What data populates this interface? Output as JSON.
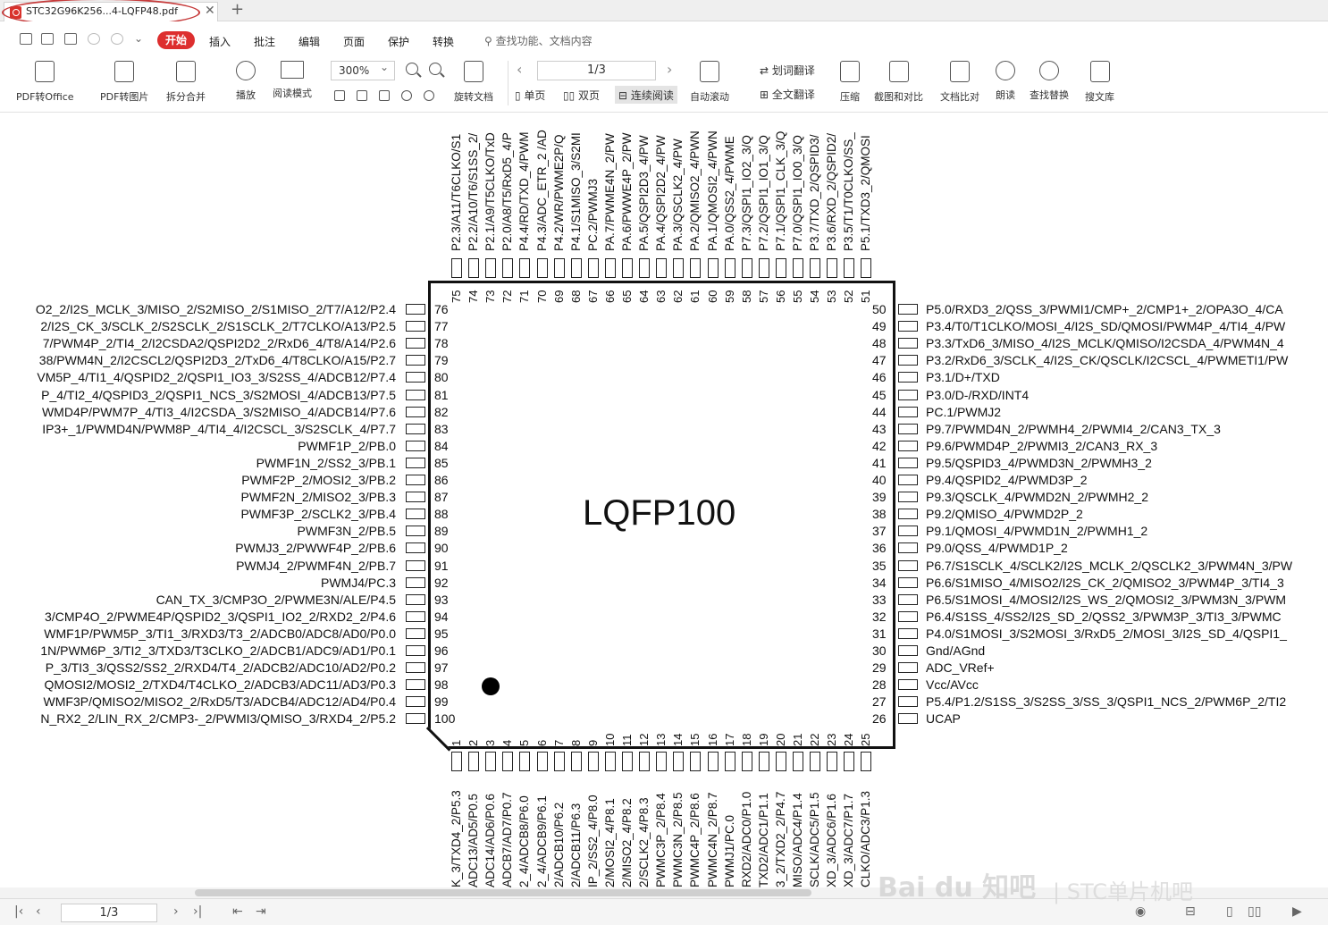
{
  "tab": {
    "title": "STC32G96K256...4-LQFP48.pdf",
    "close": "✕",
    "new_tab": "+"
  },
  "menu": {
    "items": [
      "开始",
      "插入",
      "批注",
      "编辑",
      "页面",
      "保护",
      "转换"
    ],
    "search_placeholder": "查找功能、文档内容"
  },
  "toolbar": {
    "pdf_to_office": "PDF转Office",
    "pdf_to_image": "PDF转图片",
    "split_merge": "拆分合并",
    "play": "播放",
    "read_mode": "阅读模式",
    "zoom": "300%",
    "page": "1/3",
    "rotate": "旋转文档",
    "single": "单页",
    "double": "双页",
    "continuous": "连续阅读",
    "auto_scroll": "自动滚动",
    "translate_word": "划词翻译",
    "translate_full": "全文翻译",
    "compress": "压缩",
    "screenshot_compare": "截图和对比",
    "doc_compare": "文档比对",
    "read_aloud": "朗读",
    "find_replace": "查找替换",
    "search_lib": "搜文库"
  },
  "chip": {
    "name": "LQFP100",
    "left_pins": [
      {
        "num": "76",
        "label": "O2_2/I2S_MCLK_3/MISO_2/S2MISO_2/S1MISO_2/T7/A12/P2.4"
      },
      {
        "num": "77",
        "label": "2/I2S_CK_3/SCLK_2/S2SCLK_2/S1SCLK_2/T7CLKO/A13/P2.5"
      },
      {
        "num": "78",
        "label": "7/PWM4P_2/TI4_2/I2CSDA2/QSPI2D2_2/RxD6_4/T8/A14/P2.6"
      },
      {
        "num": "79",
        "label": "38/PWM4N_2/I2CSCL2/QSPI2D3_2/TxD6_4/T8CLKO/A15/P2.7"
      },
      {
        "num": "80",
        "label": "VM5P_4/TI1_4/QSPID2_2/QSPI1_IO3_3/S2SS_4/ADCB12/P7.4"
      },
      {
        "num": "81",
        "label": "P_4/TI2_4/QSPID3_2/QSPI1_NCS_3/S2MOSI_4/ADCB13/P7.5"
      },
      {
        "num": "82",
        "label": "WMD4P/PWM7P_4/TI3_4/I2CSDA_3/S2MISO_4/ADCB14/P7.6"
      },
      {
        "num": "83",
        "label": "IP3+_1/PWMD4N/PWM8P_4/TI4_4/I2CSCL_3/S2SCLK_4/P7.7"
      },
      {
        "num": "84",
        "label": "PWMF1P_2/PB.0"
      },
      {
        "num": "85",
        "label": "PWMF1N_2/SS2_3/PB.1"
      },
      {
        "num": "86",
        "label": "PWMF2P_2/MOSI2_3/PB.2"
      },
      {
        "num": "87",
        "label": "PWMF2N_2/MISO2_3/PB.3"
      },
      {
        "num": "88",
        "label": "PWMF3P_2/SCLK2_3/PB.4"
      },
      {
        "num": "89",
        "label": "PWMF3N_2/PB.5"
      },
      {
        "num": "90",
        "label": "PWMJ3_2/PWWF4P_2/PB.6"
      },
      {
        "num": "91",
        "label": "PWMJ4_2/PWMF4N_2/PB.7"
      },
      {
        "num": "92",
        "label": "PWMJ4/PC.3"
      },
      {
        "num": "93",
        "label": "CAN_TX_3/CMP3O_2/PWME3N/ALE/P4.5"
      },
      {
        "num": "94",
        "label": "3/CMP4O_2/PWME4P/QSPID2_3/QSPI1_IO2_2/RXD2_2/P4.6"
      },
      {
        "num": "95",
        "label": "WMF1P/PWM5P_3/TI1_3/RXD3/T3_2/ADCB0/ADC8/AD0/P0.0"
      },
      {
        "num": "96",
        "label": "1N/PWM6P_3/TI2_3/TXD3/T3CLKO_2/ADCB1/ADC9/AD1/P0.1"
      },
      {
        "num": "97",
        "label": "P_3/TI3_3/QSS2/SS2_2/RXD4/T4_2/ADCB2/ADC10/AD2/P0.2"
      },
      {
        "num": "98",
        "label": "QMOSI2/MOSI2_2/TXD4/T4CLKO_2/ADCB3/ADC11/AD3/P0.3"
      },
      {
        "num": "99",
        "label": "WMF3P/QMISO2/MISO2_2/RxD5/T3/ADCB4/ADC12/AD4/P0.4"
      },
      {
        "num": "100",
        "label": "N_RX2_2/LIN_RX_2/CMP3-_2/PWMI3/QMISO_3/RXD4_2/P5.2"
      }
    ],
    "right_pins": [
      {
        "num": "50",
        "label": "P5.0/RXD3_2/QSS_3/PWMI1/CMP+_2/CMP1+_2/OPA3O_4/CA"
      },
      {
        "num": "49",
        "label": "P3.4/T0/T1CLKO/MOSI_4/I2S_SD/QMOSI/PWM4P_4/TI4_4/PW"
      },
      {
        "num": "48",
        "label": "P3.3/TxD6_3/MISO_4/I2S_MCLK/QMISO/I2CSDA_4/PWM4N_4"
      },
      {
        "num": "47",
        "label": "P3.2/RxD6_3/SCLK_4/I2S_CK/QSCLK/I2CSCL_4/PWMETI1/PW"
      },
      {
        "num": "46",
        "label": "P3.1/D+/TXD"
      },
      {
        "num": "45",
        "label": "P3.0/D-/RXD/INT4"
      },
      {
        "num": "44",
        "label": "PC.1/PWMJ2"
      },
      {
        "num": "43",
        "label": "P9.7/PWMD4N_2/PWMH4_2/PWMI4_2/CAN3_TX_3"
      },
      {
        "num": "42",
        "label": "P9.6/PWMD4P_2/PWMI3_2/CAN3_RX_3"
      },
      {
        "num": "41",
        "label": "P9.5/QSPID3_4/PWMD3N_2/PWMH3_2"
      },
      {
        "num": "40",
        "label": "P9.4/QSPID2_4/PWMD3P_2"
      },
      {
        "num": "39",
        "label": "P9.3/QSCLK_4/PWMD2N_2/PWMH2_2"
      },
      {
        "num": "38",
        "label": "P9.2/QMISO_4/PWMD2P_2"
      },
      {
        "num": "37",
        "label": "P9.1/QMOSI_4/PWMD1N_2/PWMH1_2"
      },
      {
        "num": "36",
        "label": "P9.0/QSS_4/PWMD1P_2"
      },
      {
        "num": "35",
        "label": "P6.7/S1SCLK_4/SCLK2/I2S_MCLK_2/QSCLK2_3/PWM4N_3/PW"
      },
      {
        "num": "34",
        "label": "P6.6/S1MISO_4/MISO2/I2S_CK_2/QMISO2_3/PWM4P_3/TI4_3"
      },
      {
        "num": "33",
        "label": "P6.5/S1MOSI_4/MOSI2/I2S_WS_2/QMOSI2_3/PWM3N_3/PWM"
      },
      {
        "num": "32",
        "label": "P6.4/S1SS_4/SS2/I2S_SD_2/QSS2_3/PWM3P_3/TI3_3/PWMC"
      },
      {
        "num": "31",
        "label": "P4.0/S1MOSI_3/S2MOSI_3/RxD5_2/MOSI_3/I2S_SD_4/QSPI1_"
      },
      {
        "num": "30",
        "label": "Gnd/AGnd"
      },
      {
        "num": "29",
        "label": "ADC_VRef+"
      },
      {
        "num": "28",
        "label": "Vcc/AVcc"
      },
      {
        "num": "27",
        "label": "P5.4/P1.2/S1SS_3/S2SS_3/SS_3/QSPI1_NCS_2/PWM6P_2/TI2"
      },
      {
        "num": "26",
        "label": "UCAP"
      }
    ],
    "top_pins": [
      {
        "num": "75",
        "label": "P2.3/A11/T6CLKO/S1"
      },
      {
        "num": "74",
        "label": "P2.2/A10/T6/S1SS_2/"
      },
      {
        "num": "73",
        "label": "P2.1/A9/T5CLKO/TxD"
      },
      {
        "num": "72",
        "label": "P2.0/A8/T5/RxD5_4/P"
      },
      {
        "num": "71",
        "label": "P4.4/RD/TXD_4/PWM"
      },
      {
        "num": "70",
        "label": "P4.3/ADC_ETR_2 /AD"
      },
      {
        "num": "69",
        "label": "P4.2/WR/PWME2P/Q"
      },
      {
        "num": "68",
        "label": "P4.1/S1MISO_3/S2MI"
      },
      {
        "num": "67",
        "label": "PC.2/PWMJ3"
      },
      {
        "num": "66",
        "label": "PA.7/PWME4N_2/PW"
      },
      {
        "num": "65",
        "label": "PA.6/PWWE4P_2/PW"
      },
      {
        "num": "64",
        "label": "PA.5/QSPI2D3_4/PW"
      },
      {
        "num": "63",
        "label": "PA.4/QSPI2D2_4/PW"
      },
      {
        "num": "62",
        "label": "PA.3/QSCLK2_4/PW"
      },
      {
        "num": "61",
        "label": "PA.2/QMISO2_4/PWN"
      },
      {
        "num": "60",
        "label": "PA.1/QMOSI2_4/PWN"
      },
      {
        "num": "59",
        "label": "PA.0/QSS2_4/PWME"
      },
      {
        "num": "58",
        "label": "P7.3/QSPI1_IO2_3/Q"
      },
      {
        "num": "57",
        "label": "P7.2/QSPI1_IO1_3/Q"
      },
      {
        "num": "56",
        "label": "P7.1/QSPI1_CLK_3/Q"
      },
      {
        "num": "55",
        "label": "P7.0/QSPI1_IO0_3/Q"
      },
      {
        "num": "54",
        "label": "P3.7/TXD_2/QSPID3/"
      },
      {
        "num": "53",
        "label": "P3.6/RXD_2/QSPID2/"
      },
      {
        "num": "52",
        "label": "P3.5/T1/T0CLKO/SS_"
      },
      {
        "num": "51",
        "label": "P5.1/TXD3_2/QMOSI"
      }
    ],
    "bottom_pins": [
      {
        "num": "1",
        "label": "K_3/TXD4_2/P5.3"
      },
      {
        "num": "2",
        "label": "ADC13/AD5/P0.5"
      },
      {
        "num": "3",
        "label": "ADC14/AD6/P0.6"
      },
      {
        "num": "4",
        "label": "ADCB7/AD7/P0.7"
      },
      {
        "num": "5",
        "label": "2_4/ADCB8/P6.0"
      },
      {
        "num": "6",
        "label": "2_4/ADCB9/P6.1"
      },
      {
        "num": "7",
        "label": "2/ADCB10/P6.2"
      },
      {
        "num": "8",
        "label": "2/ADCB11/P6.3"
      },
      {
        "num": "9",
        "label": "IP_2/SS2_4/P8.0"
      },
      {
        "num": "10",
        "label": "2/MOSI2_4/P8.1"
      },
      {
        "num": "11",
        "label": "2/MISO2_4/P8.2"
      },
      {
        "num": "12",
        "label": "2/SCLK2_4/P8.3"
      },
      {
        "num": "13",
        "label": "PWMC3P_2/P8.4"
      },
      {
        "num": "14",
        "label": "PWMC3N_2/P8.5"
      },
      {
        "num": "15",
        "label": "PWMC4P_2/P8.6"
      },
      {
        "num": "16",
        "label": "PWMC4N_2/P8.7"
      },
      {
        "num": "17",
        "label": "PWMJ1/PC.0"
      },
      {
        "num": "18",
        "label": "RXD2/ADC0/P1.0"
      },
      {
        "num": "19",
        "label": "TXD2/ADC1/P1.1"
      },
      {
        "num": "20",
        "label": "3_2/TXD2_2/P4.7"
      },
      {
        "num": "21",
        "label": "MISO/ADC4/P1.4"
      },
      {
        "num": "22",
        "label": "SCLK/ADC5/P1.5"
      },
      {
        "num": "23",
        "label": "XD_3/ADC6/P1.6"
      },
      {
        "num": "24",
        "label": "XD_3/ADC7/P1.7"
      },
      {
        "num": "25",
        "label": "CLKO/ADC3/P1.3"
      }
    ]
  },
  "status": {
    "page": "1/3"
  },
  "watermark": {
    "text": "Bai du 知吧",
    "sub": "| STC单片机吧"
  }
}
